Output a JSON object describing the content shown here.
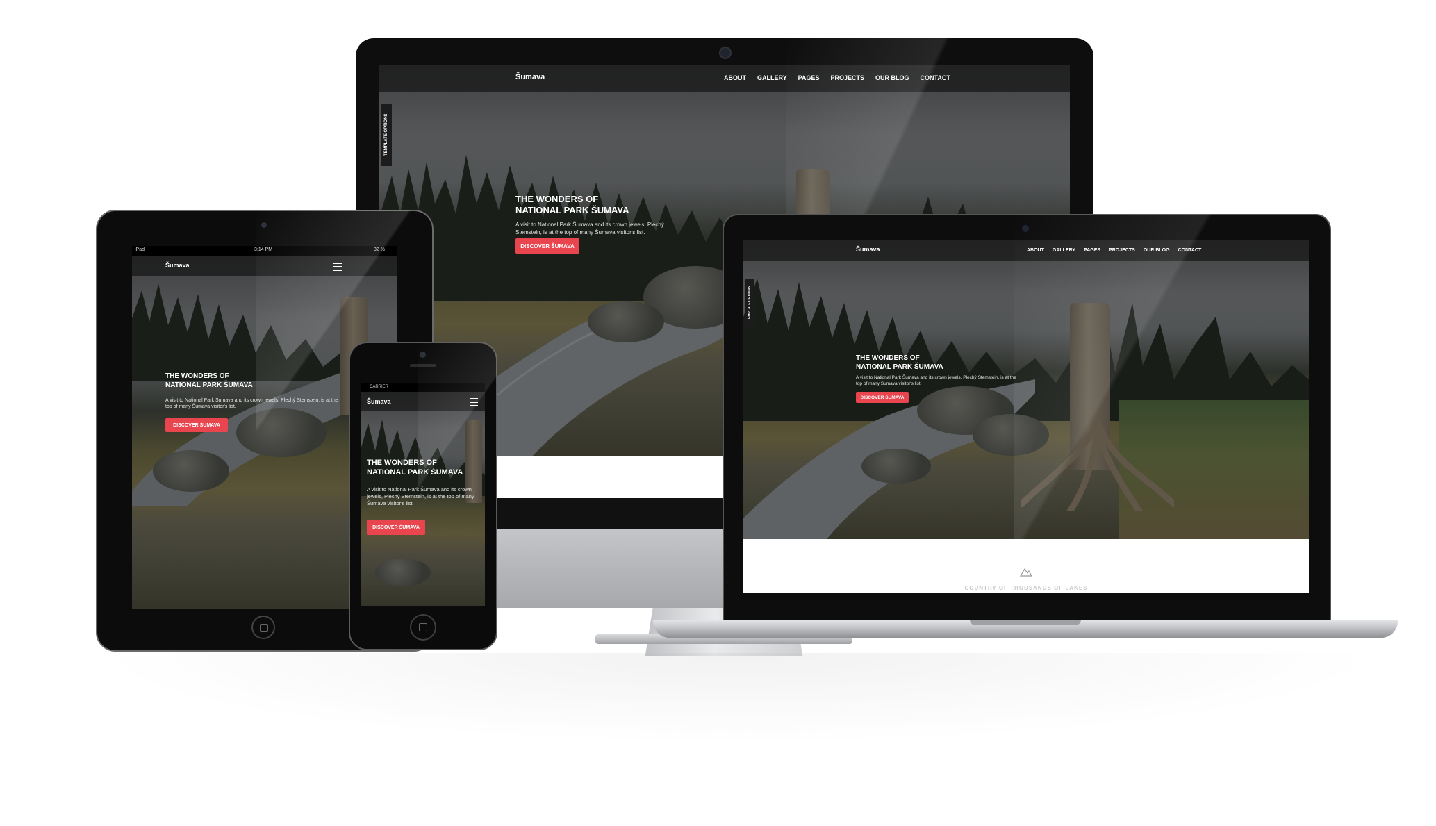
{
  "site": {
    "logo": "Šumava",
    "nav": [
      "ABOUT",
      "GALLERY",
      "PAGES",
      "PROJECTS",
      "OUR BLOG",
      "CONTACT"
    ],
    "hero_title_line1": "THE WONDERS OF",
    "hero_title_line2": "NATIONAL PARK ŠUMAVA",
    "hero_text": "A visit to National Park Šumava and its crown jewels, Plechý Stemstein, is at the top of many Šumava visitor's list.",
    "cta": "DISCOVER ŠUMAVA",
    "template_options": "TEMPLATE OPTIONS"
  },
  "tablet_status": {
    "device": "iPad",
    "time": "3:14 PM",
    "battery": "32 %"
  },
  "phone_status": {
    "carrier": "CARRIER"
  },
  "laptop_section_heading": "COUNTRY OF THOUSANDS OF LAKES",
  "colors": {
    "accent": "#e8454f",
    "navbar": "#191919",
    "device_frame": "#0e0e0e"
  },
  "icons": [
    "menu-icon",
    "mountain-icon",
    "camera-icon",
    "home-button-icon"
  ]
}
